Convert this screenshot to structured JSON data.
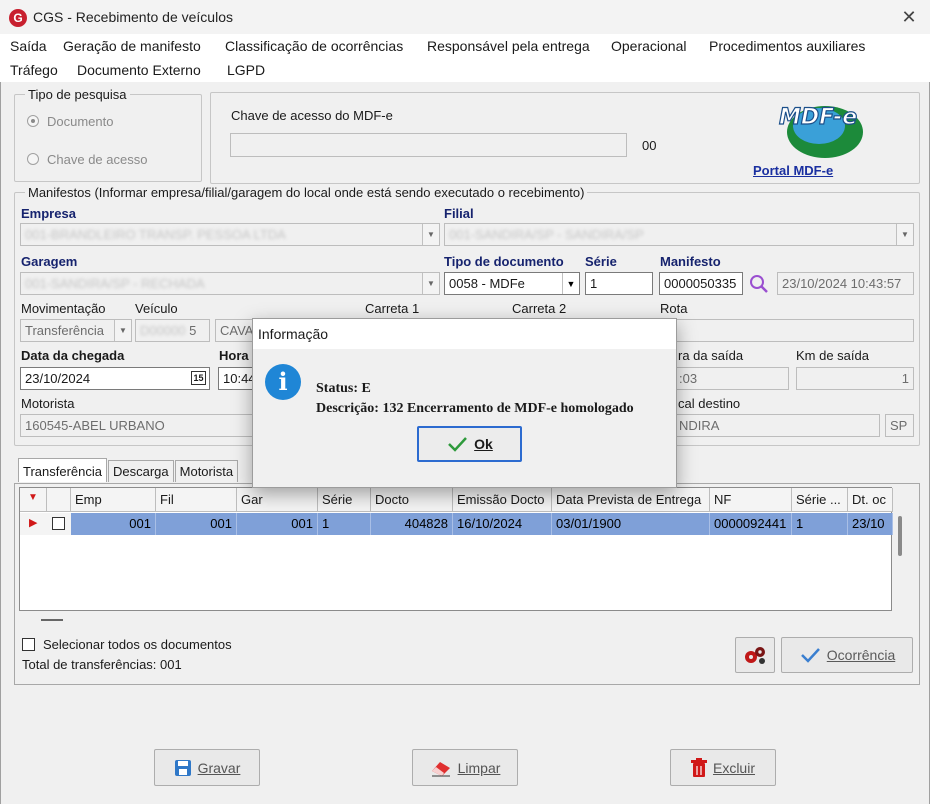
{
  "window": {
    "title": "CGS - Recebimento de veículos",
    "logo_letter": "G"
  },
  "menu": [
    "Saída",
    "Geração de manifesto",
    "Classificação de ocorrências",
    "Responsável pela entrega",
    "Operacional",
    "Procedimentos auxiliares",
    "Tráfego",
    "Documento Externo",
    "LGPD"
  ],
  "search_type": {
    "legend": "Tipo de pesquisa",
    "option_documento": "Documento",
    "option_chave": "Chave de acesso"
  },
  "mdfe_key": {
    "label": "Chave de acesso do MDF-e",
    "value": "",
    "suffix": "00",
    "portal_link": "Portal MDF-e",
    "logo_text": "MDF-e"
  },
  "manifests": {
    "legend": "Manifestos (Informar empresa/filial/garagem do local onde está sendo executado o recebimento)",
    "empresa_label": "Empresa",
    "empresa_value": "001-BRANDLEIRO TRANSP. PESSOA LTDA",
    "filial_label": "Filial",
    "filial_value": "001-SANDIRA/SP - SANDIRA/SP",
    "garagem_label": "Garagem",
    "garagem_value": "001-SANDIRA/SP - RECHADA",
    "tipo_doc_label": "Tipo de documento",
    "tipo_doc_value": "0058 - MDFe",
    "serie_label": "Série",
    "serie_value": "1",
    "manifesto_label": "Manifesto",
    "manifesto_value": "0000050335",
    "manifesto_datetime": "23/10/2024 10:43:57",
    "movimentacao_label": "Movimentação",
    "movimentacao_value": "Transferência",
    "veiculo_label": "Veículo",
    "veiculo_value": "D00000",
    "veiculo_suffix": "5",
    "veiculo_desc": "CAVA",
    "carreta1_label": "Carreta 1",
    "carreta2_label": "Carreta 2",
    "rota_label": "Rota",
    "data_chegada_label": "Data da chegada",
    "data_chegada_value": "23/10/2024",
    "hora_label": "Hora",
    "hora_value": "10:44",
    "hora_saida_label": "ra da saída",
    "hora_saida_value": ":03",
    "km_saida_label": "Km de saída",
    "km_saida_value": "1",
    "motorista_label": "Motorista",
    "motorista_value": "160545-ABEL URBANO",
    "local_destino_label": "cal destino",
    "local_destino_value": "NDIRA",
    "uf_value": "SP"
  },
  "tabs": [
    "Transferência",
    "Descarga",
    "Motorista"
  ],
  "grid": {
    "columns": [
      "Emp",
      "Fil",
      "Gar",
      "Série",
      "Docto",
      "Emissão Docto",
      "Data Prevista de Entrega",
      "NF",
      "Série ...",
      "Dt. oc"
    ],
    "rows": [
      [
        "001",
        "001",
        "001",
        "1",
        "404828",
        "16/10/2024",
        "03/01/1900",
        "0000092441",
        "1",
        "23/10"
      ]
    ]
  },
  "select_all_label": "Selecionar todos os documentos",
  "total_label": "Total de transferências: 001",
  "buttons": {
    "ocorrencia": "Ocorrência",
    "gravar": "Gravar",
    "limpar": "Limpar",
    "excluir": "Excluir"
  },
  "dialog": {
    "title": "Informação",
    "status": "Status: E",
    "descricao": "Descrição: 132 Encerramento de MDF-e homologado",
    "ok": "Ok"
  },
  "colors": {
    "accent": "#16236e",
    "selection": "#7fa0d8",
    "info": "#1f86d6",
    "check": "#2e9a3c",
    "link": "#1a2fa0"
  }
}
